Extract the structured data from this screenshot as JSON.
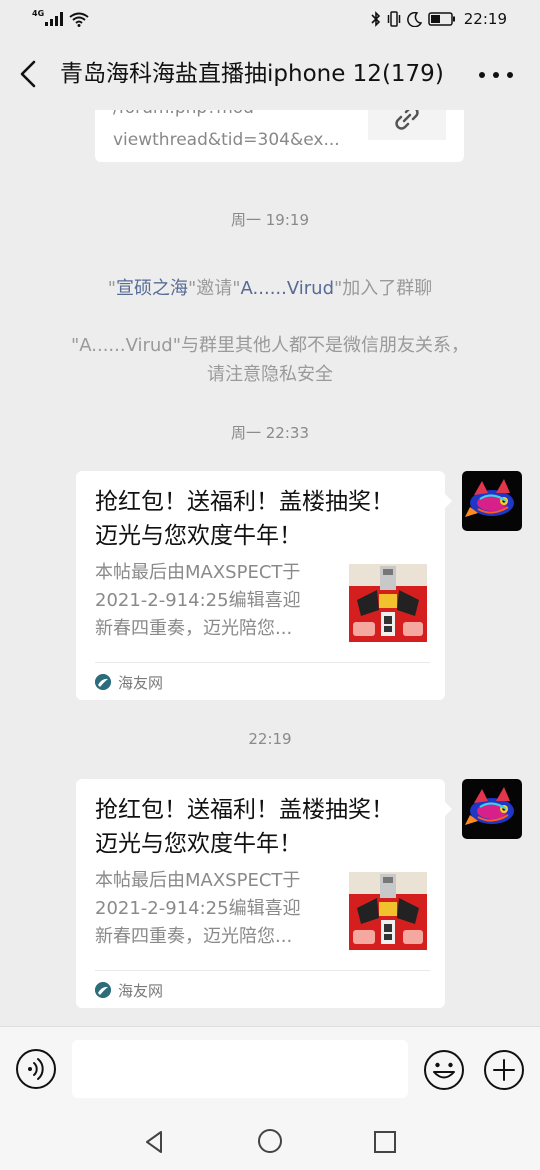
{
  "status_bar": {
    "network": "4G",
    "time": "22:19",
    "icons": [
      "signal-icon",
      "wifi-icon",
      "bluetooth-icon",
      "vibrate-icon",
      "moon-icon",
      "battery-icon"
    ]
  },
  "header": {
    "title": "青岛海科海盐直播抽iphone 12(179)",
    "icons": [
      "back-arrow-icon",
      "more-dots-icon"
    ]
  },
  "chat": {
    "link_preview": {
      "url_line1": "/forum.php?mod",
      "url_line2": "viewthread&tid=304&ex..."
    },
    "timestamp1": "周一 19:19",
    "invite_notice": {
      "quote_open": "\"",
      "inviter": "宣硕之海",
      "middle": "\"邀请\"",
      "invitee": "A......Virud",
      "end": "\"加入了群聊"
    },
    "privacy_notice": {
      "line1": "\"A......Virud\"与群里其他人都不是微信朋友关系，",
      "line2": "请注意隐私安全"
    },
    "timestamp2": "周一 22:33",
    "timestamp3": "22:19",
    "messages": [
      {
        "title_line1": "抢红包！送福利！盖楼抽奖！",
        "title_line2": "迈光与您欢度牛年！",
        "desc_line1": "本帖最后由MAXSPECT于",
        "desc_line2": "2021-2-914:25编辑喜迎",
        "desc_line3": "新春四重奏，迈光陪您...",
        "source": "海友网"
      },
      {
        "title_line1": "抢红包！送福利！盖楼抽奖！",
        "title_line2": "迈光与您欢度牛年！",
        "desc_line1": "本帖最后由MAXSPECT于",
        "desc_line2": "2021-2-914:25编辑喜迎",
        "desc_line3": "新春四重奏，迈光陪您...",
        "source": "海友网"
      }
    ]
  },
  "input_bar": {
    "value": "",
    "icons": [
      "voice-icon",
      "emoji-icon",
      "plus-icon"
    ]
  },
  "nav_bar": {
    "icons": [
      "nav-back-icon",
      "nav-home-icon",
      "nav-recent-icon"
    ]
  },
  "colors": {
    "background": "#ededed",
    "bubble": "#ffffff",
    "link_name": "#576b95",
    "system_text": "#9a9a9a",
    "thumbnail_red": "#d51e1e"
  }
}
